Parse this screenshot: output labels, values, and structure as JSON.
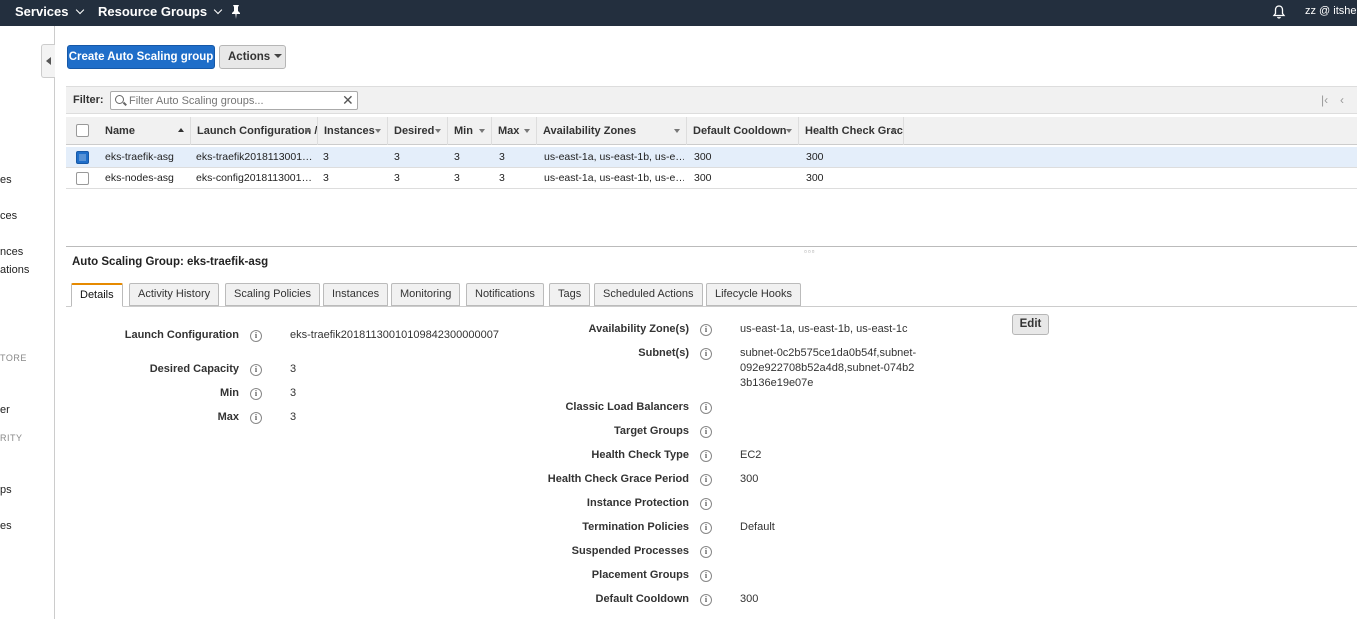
{
  "topnav": {
    "services": "Services",
    "resource_groups": "Resource Groups",
    "user": "zz @ itshell"
  },
  "sidebar": {
    "fragments": [
      "es",
      "ces",
      "nces",
      "ations",
      "TORE",
      "er",
      "RITY",
      "ps",
      "es"
    ]
  },
  "toolbar": {
    "create_label": "Create Auto Scaling group",
    "actions_label": "Actions"
  },
  "filter": {
    "label": "Filter:",
    "placeholder": "Filter Auto Scaling groups..."
  },
  "table": {
    "columns": [
      "Name",
      "Launch Configuration / ",
      "Instances",
      "Desired",
      "Min",
      "Max",
      "Availability Zones",
      "Default Cooldown",
      "Health Check Grac"
    ],
    "rows": [
      {
        "name": "eks-traefik-asg",
        "launch": "eks-traefik2018113001…",
        "instances": "3",
        "desired": "3",
        "min": "3",
        "max": "3",
        "az": "us-east-1a, us-east-1b, us-e…",
        "cooldown": "300",
        "grace": "300",
        "selected": true
      },
      {
        "name": "eks-nodes-asg",
        "launch": "eks-config2018113001…",
        "instances": "3",
        "desired": "3",
        "min": "3",
        "max": "3",
        "az": "us-east-1a, us-east-1b, us-e…",
        "cooldown": "300",
        "grace": "300",
        "selected": false
      }
    ]
  },
  "detail": {
    "title": "Auto Scaling Group: eks-traefik-asg",
    "tabs": [
      "Details",
      "Activity History",
      "Scaling Policies",
      "Instances",
      "Monitoring",
      "Notifications",
      "Tags",
      "Scheduled Actions",
      "Lifecycle Hooks"
    ],
    "active_tab": "Details",
    "edit_label": "Edit",
    "left": [
      {
        "label": "Launch Configuration",
        "value": "eks-traefik20181130010109842300000007"
      },
      {
        "label": "Desired Capacity",
        "value": "3"
      },
      {
        "label": "Min",
        "value": "3"
      },
      {
        "label": "Max",
        "value": "3"
      }
    ],
    "right": [
      {
        "label": "Availability Zone(s)",
        "value": "us-east-1a, us-east-1b, us-east-1c"
      },
      {
        "label": "Subnet(s)",
        "value": "subnet-0c2b575ce1da0b54f,subnet-092e922708b52a4d8,subnet-074b23b136e19e07e"
      },
      {
        "label": "Classic Load Balancers",
        "value": ""
      },
      {
        "label": "Target Groups",
        "value": ""
      },
      {
        "label": "Health Check Type",
        "value": "EC2"
      },
      {
        "label": "Health Check Grace Period",
        "value": "300"
      },
      {
        "label": "Instance Protection",
        "value": ""
      },
      {
        "label": "Termination Policies",
        "value": "Default"
      },
      {
        "label": "Suspended Processes",
        "value": ""
      },
      {
        "label": "Placement Groups",
        "value": ""
      },
      {
        "label": "Default Cooldown",
        "value": "300"
      }
    ]
  },
  "colors": {
    "nav_bg": "#232f3e",
    "primary": "#1f6ec9",
    "tab_accent": "#e68a00",
    "selected_row": "#e4eefa"
  }
}
